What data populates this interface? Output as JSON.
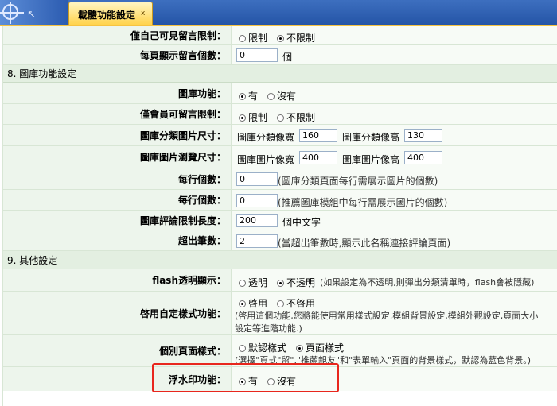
{
  "tab": {
    "label": "載體功能設定",
    "close": "ⅹ"
  },
  "rows": {
    "self_comment": {
      "label": "僅自己可見留言限制：",
      "opt1": "限制",
      "opt2": "不限制",
      "selected": "不限制"
    },
    "per_page": {
      "label": "每頁顯示留言個數：",
      "value": "0",
      "unit": "個"
    },
    "section8": "8. 圖庫功能設定",
    "gallery_func": {
      "label": "圖庫功能：",
      "opt1": "有",
      "opt2": "沒有",
      "selected": "有"
    },
    "member_comment": {
      "label": "僅會員可留言限制：",
      "opt1": "限制",
      "opt2": "不限制",
      "selected": "限制"
    },
    "cat_size": {
      "label": "圖庫分類圖片尺寸：",
      "w_label": "圖庫分類像寬",
      "w_value": "160",
      "h_label": "圖庫分類像高",
      "h_value": "130"
    },
    "view_size": {
      "label": "圖庫圖片瀏覽尺寸：",
      "w_label": "圖庫圖片像寬",
      "w_value": "400",
      "h_label": "圖庫圖片像高",
      "h_value": "400"
    },
    "per_row_1": {
      "label": "每行個數：",
      "value": "0",
      "note": "(圖庫分類頁面每行需展示圖片的個數)"
    },
    "per_row_2": {
      "label": "每行個數：",
      "value": "0",
      "note": "(推薦圖庫模組中每行需展示圖片的個數)"
    },
    "comment_len": {
      "label": "圖庫評論限制長度：",
      "value": "200",
      "unit": "個中文字"
    },
    "overflow": {
      "label": "超出筆數：",
      "value": "2",
      "note": "(當超出筆數時,顯示此名稱連接評論頁面)"
    },
    "section9": "9. 其他設定",
    "flash": {
      "label": "flash透明顯示：",
      "opt1": "透明",
      "opt2": "不透明",
      "selected": "不透明",
      "note": "(如果設定為不透明,則彈出分類清單時，flash會被隱藏)"
    },
    "custom_style": {
      "label": "啓用自定樣式功能：",
      "opt1": "啓用",
      "opt2": "不啓用",
      "selected": "啓用",
      "note1": "(啓用這個功能,您將能使用常用樣式設定,模組背景設定,模組外觀設定,頁面大小",
      "note2": "設定等進階功能.)"
    },
    "page_style": {
      "label": "個別頁面樣式：",
      "opt1": "默認樣式",
      "opt2": "頁面樣式",
      "selected": "頁面樣式",
      "note": "(選擇\"頁式\"留\",\"推薦親友\"和\"表單輸入\"頁面的背景樣式，默認為藍色背景。)"
    },
    "watermark": {
      "label": "浮水印功能：",
      "opt1": "有",
      "opt2": "沒有",
      "selected": "有"
    }
  },
  "colors": {
    "highlight": "#e8261d",
    "label_bg": "#edf5ec",
    "section_bg": "#e3efe1",
    "tab": "#ffd34d"
  }
}
